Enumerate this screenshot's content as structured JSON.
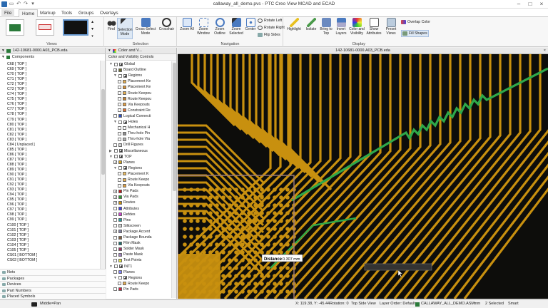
{
  "window": {
    "title": "callaway_all_demo.pvs - PTC Creo View MCAD and ECAD"
  },
  "tabs": {
    "file": "File",
    "home": "Home",
    "markup": "Markup",
    "tools": "Tools",
    "groups": "Groups",
    "overlays": "Overlays"
  },
  "ribbon": {
    "find": "Find",
    "selection_mode": "Selection Mode",
    "cross_select": "Cross-Select Mode",
    "crosshair": "Crosshair",
    "zoom_all": "Zoom All",
    "zoom_window": "Zoom Window",
    "zoom_outline": "Zoom Outline",
    "zoom_selected": "Zoom Selected",
    "center": "Center",
    "rotate_left": "Rotate Left",
    "rotate_right": "Rotate Right",
    "flip_sides": "Flip Sides",
    "highlight": "Highlight",
    "isolate": "Isolate",
    "bring_to_top": "Bring to Top",
    "invert_layers": "Invert Layers",
    "color_visibility": "Color and Visibility",
    "show_attributes": "Show Attributes",
    "preset_views": "Preset Views",
    "overlap_color": "Overlap Color",
    "fill_shapes": "Fill Shapes",
    "groups": {
      "views": "Views",
      "selection": "Selection",
      "navigation": "Navigation",
      "display": "Display"
    }
  },
  "left_panel": {
    "file": "142-10681-0000.A03_PCB.eda",
    "tree_root": "Components",
    "items": [
      "C68 [ TOP ]",
      "C69 [ TOP ]",
      "C70 [ TOP ]",
      "C71 [ TOP ]",
      "C72 [ TOP ]",
      "C73 [ TOP ]",
      "C74 [ TOP ]",
      "C75 [ TOP ]",
      "C76 [ TOP ]",
      "C77 [ TOP ]",
      "C78 [ TOP ]",
      "C79 [ TOP ]",
      "C80 [ TOP ]",
      "C81 [ TOP ]",
      "C82 [ TOP ]",
      "C83 [ TOP ]",
      "C84 [ Unplaced ]",
      "C85 [ TOP ]",
      "C86 [ TOP ]",
      "C87 [ TOP ]",
      "C88 [ TOP ]",
      "C89 [ TOP ]",
      "C90 [ TOP ]",
      "C91 [ TOP ]",
      "C92 [ TOP ]",
      "C93 [ TOP ]",
      "C94 [ TOP ]",
      "C95 [ TOP ]",
      "C96 [ TOP ]",
      "C97 [ TOP ]",
      "C98 [ TOP ]",
      "C99 [ TOP ]",
      "C100 [ TOP ]",
      "C101 [ TOP ]",
      "C102 [ TOP ]",
      "C103 [ TOP ]",
      "C104 [ TOP ]",
      "C105 [ TOP ]",
      "CS01 [ BOTTOM ]",
      "CS02 [ BOTTOM ]"
    ],
    "sections": [
      "Nets",
      "Packages",
      "Devices",
      "Part Numbers",
      "Placed Symbols"
    ]
  },
  "color_panel": {
    "tab": "Color and V...",
    "subtitle": "Color and Visibility Controls",
    "rows": [
      {
        "label": "Global",
        "exp": "▼"
      },
      {
        "label": "Board Outline",
        "color": "#6b6b2b",
        "checked": true
      },
      {
        "label": "Regions",
        "exp": "▼"
      },
      {
        "label": "Placement Ke",
        "color": "#e8b050"
      },
      {
        "label": "Placement Ke",
        "color": "#d89030"
      },
      {
        "label": "Route Keepou",
        "color": "#e8b050"
      },
      {
        "label": "Route Keepou",
        "color": "#c08030"
      },
      {
        "label": "Via Keepouts",
        "color": "#e8a040"
      },
      {
        "label": "Constraint Re",
        "color": "#e07030"
      },
      {
        "label": "Logical Connecti",
        "color": "#3050c0"
      },
      {
        "label": "Holes",
        "exp": "▼"
      },
      {
        "label": "Mechanical H",
        "color": "#ffffff"
      },
      {
        "label": "Thru-hole Pin",
        "color": "#909090"
      },
      {
        "label": "Thru-hole Via",
        "color": "#b0b0b0"
      },
      {
        "label": "Drill Figures",
        "color": "#d0d0d0"
      },
      {
        "label": "Miscellaneous",
        "exp": "▶"
      },
      {
        "label": "TOP",
        "exp": "▼"
      },
      {
        "label": "Planes",
        "color": "#d0a020",
        "checked": true
      },
      {
        "label": "Regions",
        "exp": "▼"
      },
      {
        "label": "Placement K",
        "color": "#f0c060"
      },
      {
        "label": "Route Keepo",
        "color": "#e8b050"
      },
      {
        "label": "Via Keepouts",
        "color": "#e0a040"
      },
      {
        "label": "Pin Pads",
        "color": "#c01818",
        "checked": true
      },
      {
        "label": "Via Pads",
        "color": "#30a030",
        "checked": true
      },
      {
        "label": "Routes",
        "color": "#c89010",
        "checked": true
      },
      {
        "label": "Attributes",
        "color": "#4040e0"
      },
      {
        "label": "Refdes",
        "color": "#d040d0"
      },
      {
        "label": "Pins",
        "color": "#20a0a0"
      },
      {
        "label": "Silkscreen",
        "color": "#d0d0d0"
      },
      {
        "label": "Package Accent",
        "color": "#8080a0",
        "checked": true
      },
      {
        "label": "Package Bounda",
        "color": "#806040"
      },
      {
        "label": "Film Mask",
        "color": "#207070"
      },
      {
        "label": "Solder Mask",
        "color": "#a03060"
      },
      {
        "label": "Paste Mask",
        "color": "#a080c0"
      },
      {
        "label": "Test Points",
        "color": "#e0e040"
      },
      {
        "label": "INT1",
        "exp": "▼"
      },
      {
        "label": "Planes",
        "color": "#8080ff"
      },
      {
        "label": "Regions",
        "exp": "▼"
      },
      {
        "label": "Route Keepo",
        "color": "#e8b050"
      },
      {
        "label": "Pin Pads",
        "color": "#d02040"
      }
    ]
  },
  "viewport": {
    "title": "142-10681-0000.A03_PCB.eda",
    "measure_label": "Distance",
    "measure_value": "0.307 mm",
    "trace_color": "#c8900f",
    "highlight_color": "#2ea84a",
    "background": "#0d0d0b"
  },
  "status": {
    "mode": "Middle=Pan",
    "coords": "X: 119.38, Y: -45.44",
    "rotation": "Rotation: 0",
    "view": "Top Side View",
    "layer_order": "Layer Order: Default",
    "assembly": "CALLAWAY_ALL_DEMO.ASM",
    "units": "mm",
    "selected": "2 Selected",
    "snap": "Smart"
  }
}
